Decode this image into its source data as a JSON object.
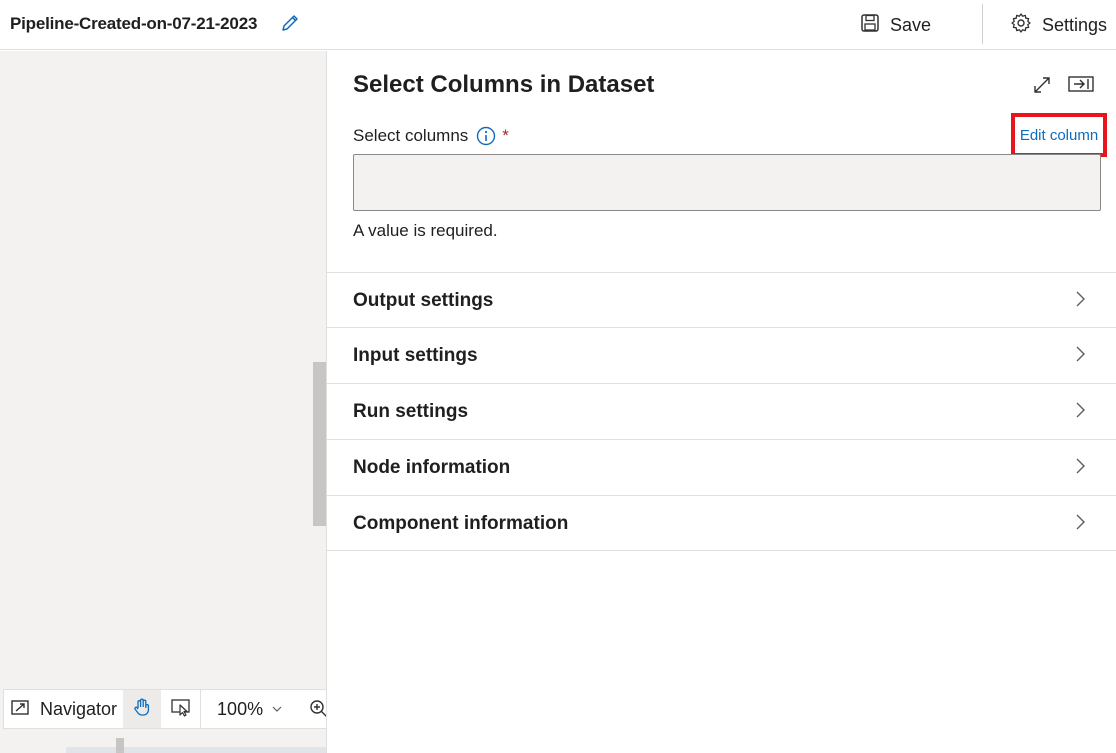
{
  "header": {
    "pipeline_title": "Pipeline-Created-on-07-21-2023",
    "save_label": "Save",
    "settings_label": "Settings"
  },
  "canvas": {
    "toolbar": {
      "navigator_label": "Navigator",
      "zoom_value": "100%"
    }
  },
  "panel": {
    "title": "Select Columns in Dataset",
    "select_columns": {
      "label": "Select columns",
      "required_mark": "*",
      "edit_link": "Edit column",
      "value": "",
      "validation_message": "A value is required."
    },
    "sections": [
      {
        "label": "Output settings"
      },
      {
        "label": "Input settings"
      },
      {
        "label": "Run settings"
      },
      {
        "label": "Node information"
      },
      {
        "label": "Component information"
      }
    ]
  },
  "colors": {
    "accent": "#0f6cbd",
    "highlight_box": "#e8141e",
    "required": "#a4262c",
    "canvas_bg": "#f3f2f1"
  },
  "icons": [
    "edit-icon",
    "save-icon",
    "gear-icon",
    "navigator-icon",
    "hand-icon",
    "select-icon",
    "chevron-down-icon",
    "zoom-in-icon",
    "expand-icon",
    "collapse-panel-icon",
    "info-icon",
    "chevron-right-icon"
  ]
}
